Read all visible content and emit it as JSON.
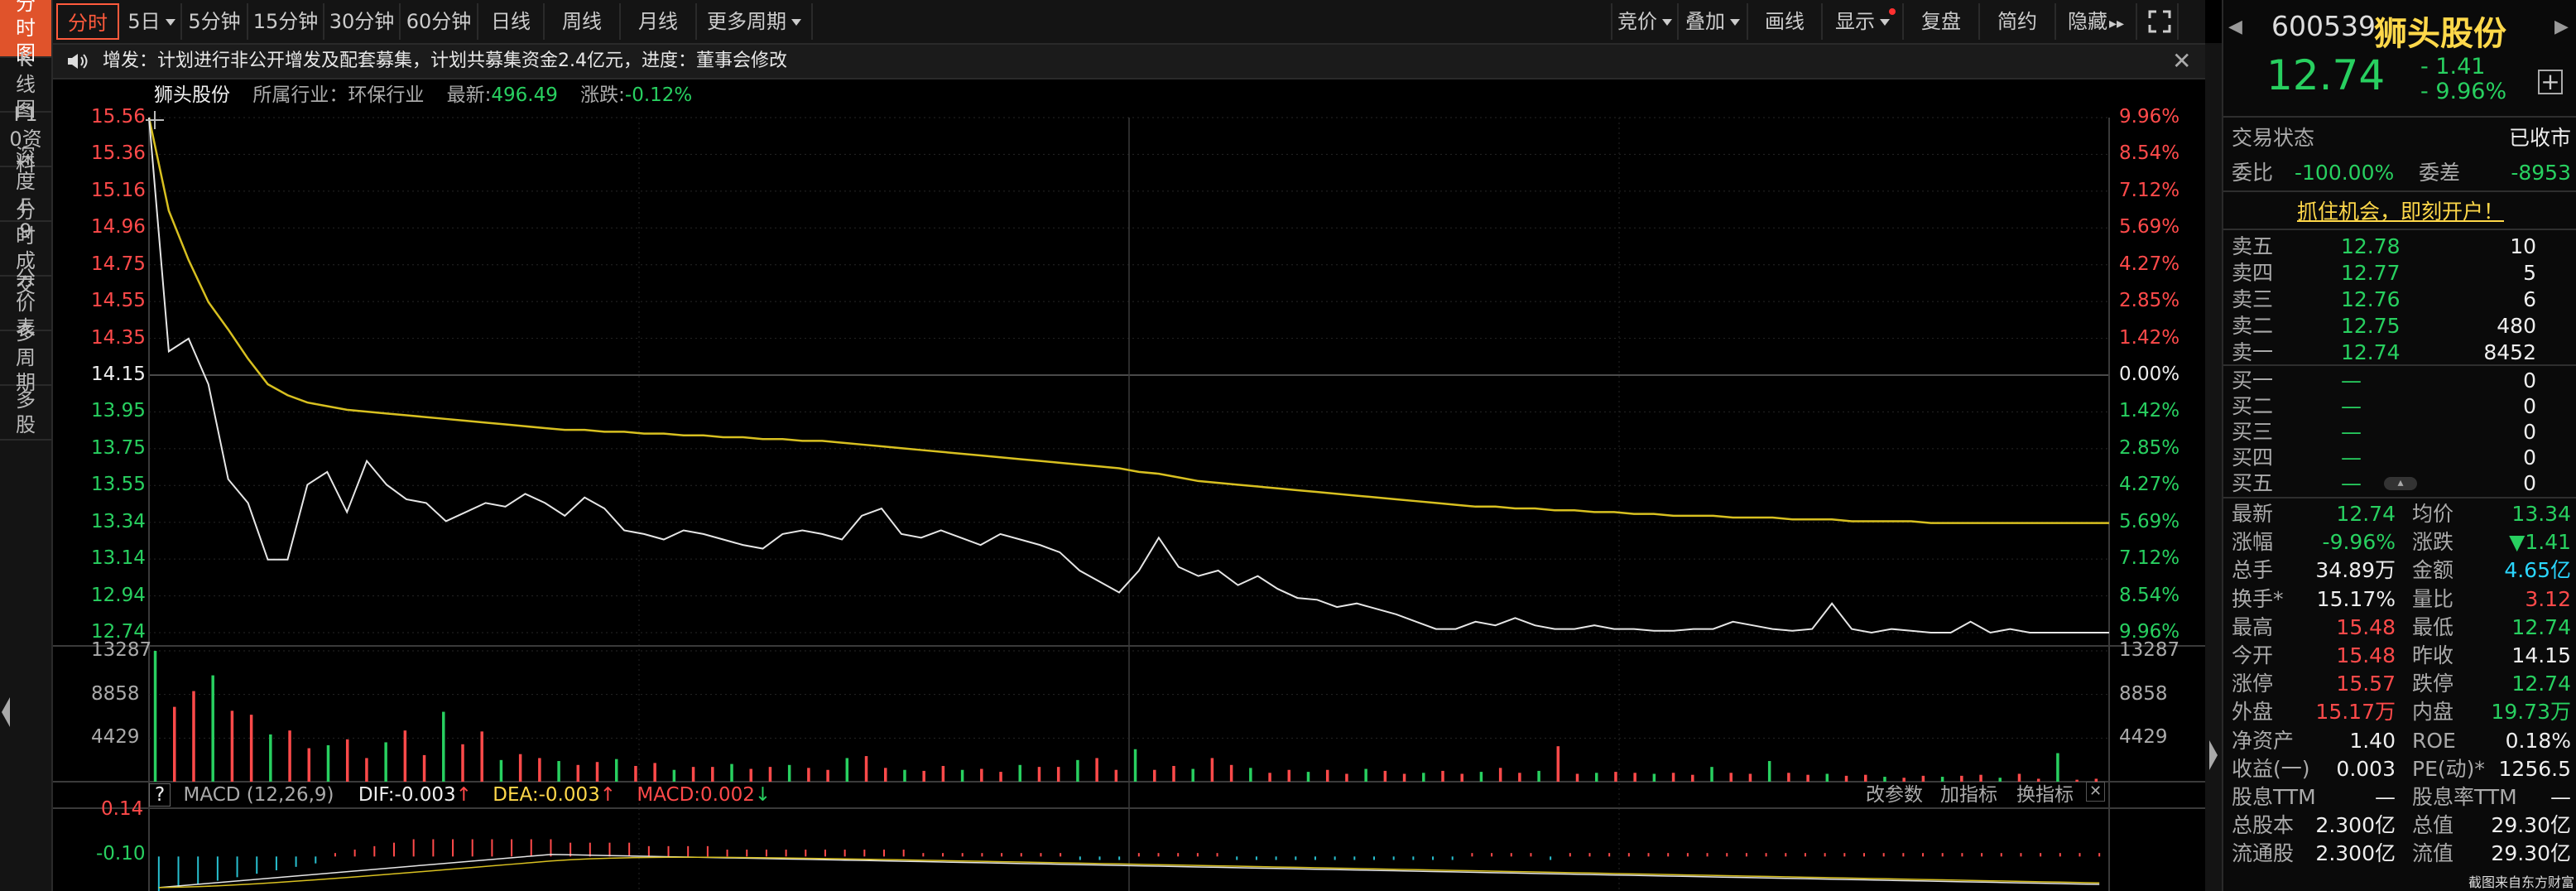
{
  "sidebar": {
    "tabs": [
      "分时图",
      "K线图",
      "F10资料",
      "深度F9",
      "分时成交",
      "分价表",
      "多周期",
      "多股"
    ]
  },
  "toolbar": {
    "left": [
      "分时",
      "5日",
      "5分钟",
      "15分钟",
      "30分钟",
      "60分钟",
      "日线",
      "周线",
      "月线",
      "更多周期"
    ],
    "right": [
      "竞价",
      "叠加",
      "画线",
      "显示",
      "复盘",
      "简约",
      "隐藏"
    ]
  },
  "notice": {
    "text": "增发：计划进行非公开增发及配套募集，计划共募集资金2.4亿元，进度：董事会修改"
  },
  "chart_header": {
    "name": "狮头股份",
    "industry": "所属行业：环保行业",
    "latest_label": "最新:",
    "latest": "496.49",
    "change_label": "涨跌:",
    "change": "-0.12%"
  },
  "colors": {
    "up": "#ff4a4a",
    "down": "#28d060",
    "avg_line": "#d8c020",
    "price_line": "#e6e6e6",
    "macd_pos": "#ff4a4a",
    "macd_neg": "#28c0d0"
  },
  "chart_data": [
    {
      "type": "line",
      "series": [
        {
          "name": "价格",
          "values": [
            15.56,
            14.28,
            14.35,
            14.1,
            13.58,
            13.45,
            13.14,
            13.14,
            13.55,
            13.62,
            13.4,
            13.68,
            13.55,
            13.47,
            13.45,
            13.35,
            13.4,
            13.45,
            13.43,
            13.5,
            13.45,
            13.38,
            13.48,
            13.42,
            13.3,
            13.28,
            13.25,
            13.3,
            13.28,
            13.25,
            13.22,
            13.2,
            13.28,
            13.3,
            13.28,
            13.25,
            13.38,
            13.42,
            13.28,
            13.26,
            13.3,
            13.26,
            13.22,
            13.28,
            13.25,
            13.22,
            13.18,
            13.08,
            13.02,
            12.96,
            13.08,
            13.26,
            13.1,
            13.05,
            13.08,
            13.0,
            13.05,
            12.98,
            12.93,
            12.92,
            12.88,
            12.9,
            12.87,
            12.84,
            12.8,
            12.76,
            12.76,
            12.8,
            12.78,
            12.82,
            12.78,
            12.76,
            12.76,
            12.78,
            12.76,
            12.76,
            12.75,
            12.75,
            12.76,
            12.76,
            12.8,
            12.78,
            12.76,
            12.75,
            12.76,
            12.9,
            12.76,
            12.74,
            12.76,
            12.75,
            12.74,
            12.74,
            12.8,
            12.74,
            12.76,
            12.74,
            12.74,
            12.74,
            12.74,
            12.74
          ]
        },
        {
          "name": "均价",
          "values": [
            15.56,
            15.05,
            14.78,
            14.55,
            14.4,
            14.24,
            14.1,
            14.04,
            14.0,
            13.98,
            13.96,
            13.95,
            13.94,
            13.93,
            13.92,
            13.91,
            13.9,
            13.89,
            13.88,
            13.87,
            13.86,
            13.85,
            13.85,
            13.84,
            13.84,
            13.83,
            13.83,
            13.82,
            13.82,
            13.81,
            13.81,
            13.8,
            13.8,
            13.79,
            13.79,
            13.78,
            13.77,
            13.76,
            13.75,
            13.74,
            13.73,
            13.72,
            13.71,
            13.7,
            13.69,
            13.68,
            13.67,
            13.66,
            13.65,
            13.64,
            13.62,
            13.61,
            13.59,
            13.57,
            13.56,
            13.55,
            13.54,
            13.53,
            13.52,
            13.51,
            13.5,
            13.49,
            13.48,
            13.47,
            13.46,
            13.45,
            13.44,
            13.43,
            13.43,
            13.42,
            13.42,
            13.41,
            13.41,
            13.4,
            13.4,
            13.39,
            13.39,
            13.38,
            13.38,
            13.38,
            13.37,
            13.37,
            13.37,
            13.36,
            13.36,
            13.36,
            13.35,
            13.35,
            13.35,
            13.35,
            13.34,
            13.34,
            13.34,
            13.34,
            13.34,
            13.34,
            13.34,
            13.34,
            13.34,
            13.34
          ]
        }
      ],
      "y_left": [
        "15.56",
        "15.36",
        "15.16",
        "14.96",
        "14.75",
        "14.55",
        "14.35",
        "14.15",
        "13.95",
        "13.75",
        "13.55",
        "13.34",
        "13.14",
        "12.94",
        "12.74"
      ],
      "y_right": [
        "9.96%",
        "8.54%",
        "7.12%",
        "5.69%",
        "4.27%",
        "2.85%",
        "1.42%",
        "0.00%",
        "1.42%",
        "2.85%",
        "4.27%",
        "5.69%",
        "7.12%",
        "8.54%",
        "9.96%"
      ],
      "ylim": [
        12.74,
        15.56
      ]
    },
    {
      "type": "bar",
      "title": "成交量",
      "y_labels": [
        "13287",
        "8858",
        "4429"
      ],
      "ylim": [
        0,
        13287
      ],
      "values": [
        13287,
        7600,
        9200,
        10800,
        7200,
        6800,
        4800,
        5200,
        3400,
        3700,
        4300,
        2400,
        4000,
        5200,
        2700,
        7100,
        3800,
        5100,
        2200,
        2800,
        2400,
        2100,
        1700,
        2000,
        2300,
        1600,
        1900,
        1200,
        1500,
        1500,
        1800,
        1300,
        1500,
        1700,
        1400,
        1200,
        2400,
        2600,
        1400,
        1200,
        1100,
        1600,
        1200,
        1300,
        1000,
        1700,
        1500,
        1500,
        2200,
        2400,
        1200,
        3300,
        1200,
        1600,
        1300,
        2400,
        1700,
        1400,
        900,
        1200,
        1000,
        1200,
        800,
        1300,
        1100,
        800,
        900,
        1100,
        800,
        1000,
        1400,
        900,
        1100,
        3600,
        800,
        900,
        1000,
        900,
        800,
        900,
        700,
        1500,
        900,
        800,
        2100,
        900,
        700,
        800,
        600,
        700,
        500,
        400,
        600,
        500,
        600,
        700,
        400,
        800,
        300,
        2900,
        200,
        300
      ]
    },
    {
      "type": "bar",
      "title": "MACD (12,26,9)",
      "y_labels": [
        "0.14",
        "-0.10"
      ],
      "ylim": [
        -0.1,
        0.14
      ],
      "values": [
        -0.1,
        -0.09,
        -0.08,
        -0.07,
        -0.06,
        -0.05,
        -0.04,
        -0.03,
        -0.02,
        0.01,
        0.02,
        0.03,
        0.04,
        0.05,
        0.05,
        0.05,
        0.05,
        0.05,
        0.05,
        0.05,
        0.05,
        0.04,
        0.04,
        0.04,
        0.04,
        0.03,
        0.03,
        0.03,
        0.03,
        0.02,
        0.02,
        0.02,
        0.02,
        0.02,
        0.02,
        0.02,
        0.02,
        0.02,
        0.02,
        0.01,
        0.01,
        0.01,
        0.01,
        0.01,
        0.01,
        0.01,
        0.01,
        -0.01,
        -0.01,
        -0.01,
        0.01,
        0.01,
        0.01,
        0.01,
        0.01,
        -0.01,
        -0.01,
        -0.01,
        -0.01,
        -0.01,
        -0.01,
        -0.01,
        -0.01,
        -0.01,
        -0.01,
        -0.01,
        -0.01,
        0.01,
        0.01,
        0.01,
        0.01,
        -0.01,
        0.01,
        0.01,
        0.01,
        0.01,
        0.01,
        0.01,
        0.01,
        0.01,
        0.01,
        0.01,
        0.01,
        0.01,
        0.01,
        0.01,
        0.01,
        0.01,
        0.01,
        0.01,
        0.01,
        0.01,
        0.01,
        0.01,
        0.01,
        0.01,
        0.01,
        0.01,
        0.01,
        0.01
      ]
    }
  ],
  "macd_header": {
    "help": "?",
    "name": "MACD (12,26,9)",
    "dif": "DIF:-0.003",
    "dea": "DEA:-0.003",
    "macd": "MACD:0.002",
    "btn1": "改参数",
    "btn2": "加指标",
    "btn3": "换指标"
  },
  "quote": {
    "code": "600539",
    "name": "狮头股份",
    "price": "12.74",
    "change": "- 1.41",
    "pct": "- 9.96%",
    "trade_status_label": "交易状态",
    "trade_status": "已收市",
    "wb_label": "委比",
    "wb": "-100.00%",
    "wc_label": "委差",
    "wc": "-8953",
    "promo": "抓住机会，即刻开户！",
    "asks": [
      {
        "label": "卖五",
        "price": "12.78",
        "vol": "10"
      },
      {
        "label": "卖四",
        "price": "12.77",
        "vol": "5"
      },
      {
        "label": "卖三",
        "price": "12.76",
        "vol": "6"
      },
      {
        "label": "卖二",
        "price": "12.75",
        "vol": "480"
      },
      {
        "label": "卖一",
        "price": "12.74",
        "vol": "8452"
      }
    ],
    "bids": [
      {
        "label": "买一",
        "price": "—",
        "vol": "0"
      },
      {
        "label": "买二",
        "price": "—",
        "vol": "0"
      },
      {
        "label": "买三",
        "price": "—",
        "vol": "0"
      },
      {
        "label": "买四",
        "price": "—",
        "vol": "0"
      },
      {
        "label": "买五",
        "price": "—",
        "vol": "0"
      }
    ],
    "stats": [
      [
        "最新",
        "12.74",
        "green",
        "均价",
        "13.34",
        "green"
      ],
      [
        "涨幅",
        "-9.96%",
        "green",
        "涨跌",
        "▼1.41",
        "green"
      ],
      [
        "总手",
        "34.89万",
        "white",
        "金额",
        "4.65亿",
        "cyan"
      ],
      [
        "换手*",
        "15.17%",
        "white",
        "量比",
        "3.12",
        "red"
      ],
      [
        "最高",
        "15.48",
        "red",
        "最低",
        "12.74",
        "green"
      ],
      [
        "今开",
        "15.48",
        "red",
        "昨收",
        "14.15",
        "white"
      ],
      [
        "涨停",
        "15.57",
        "red",
        "跌停",
        "12.74",
        "green"
      ],
      [
        "外盘",
        "15.17万",
        "red",
        "内盘",
        "19.73万",
        "green"
      ],
      [
        "净资产",
        "1.40",
        "white",
        "ROE",
        "0.18%",
        "white"
      ],
      [
        "收益(一)",
        "0.003",
        "white",
        "PE(动)*",
        "1256.5",
        "white"
      ],
      [
        "股息TTM",
        "—",
        "white",
        "股息率TTM",
        "—",
        "white"
      ],
      [
        "总股本",
        "2.300亿",
        "white",
        "总值",
        "29.30亿",
        "white"
      ],
      [
        "流通股",
        "2.300亿",
        "white",
        "流值",
        "29.30亿",
        "white"
      ]
    ],
    "watermark": "截图来自东方财富"
  }
}
